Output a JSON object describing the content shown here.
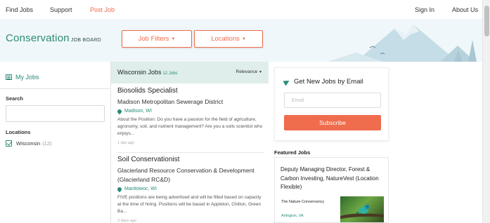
{
  "topnav": {
    "find_jobs": "Find Jobs",
    "support": "Support",
    "post_job": "Post Job",
    "sign_in": "Sign In",
    "about_us": "About Us"
  },
  "hero": {
    "logo_main": "Conservation",
    "logo_sub": "JOB BOARD",
    "job_filters": "Job Filters",
    "locations": "Locations"
  },
  "sidebar": {
    "my_jobs": "My Jobs",
    "search_label": "Search",
    "locations_label": "Locations",
    "location_items": [
      {
        "label": "Wisconsin",
        "count": "(12)",
        "checked": true
      }
    ]
  },
  "results": {
    "title": "Wisconsin Jobs",
    "count": "12 Jobs",
    "sort": "Relevance",
    "jobs": [
      {
        "title": "Biosolids Specialist",
        "company": "Madison Metropolitan Sewerage District",
        "location": "Madison, WI",
        "description": "About the Position: Do you have a passion for the field of agriculture, agronomy, soil, and nutrient management? Are you a soils scientist who enjoys...",
        "age": "1 day ago"
      },
      {
        "title": "Soil Conservationist",
        "company": "Glacierland Resource Conservation & Development (Glacierland RC&D)",
        "location": "Manitowoc, WI",
        "description": "FIVE positions are being advertised and will be filled based on capacity at the time of hiring. Positions will be based in Appleton, Chilton, Green Ba...",
        "age": "3 days ago"
      }
    ]
  },
  "email_alert": {
    "heading": "Get New Jobs by Email",
    "placeholder": "Email",
    "button": "Subscribe"
  },
  "featured": {
    "heading": "Featured Jobs",
    "title": "Deputy Managing Director, Forest & Carbon Investing, NatureVest (Location Flexible)",
    "org": "The Nature Conservancy",
    "location": "Arlington, VA"
  },
  "colors": {
    "accent": "#ef6c4c",
    "brand": "#2a8a78",
    "hero_bg": "#f0f7fa",
    "results_header_bg": "#dfeeea"
  }
}
